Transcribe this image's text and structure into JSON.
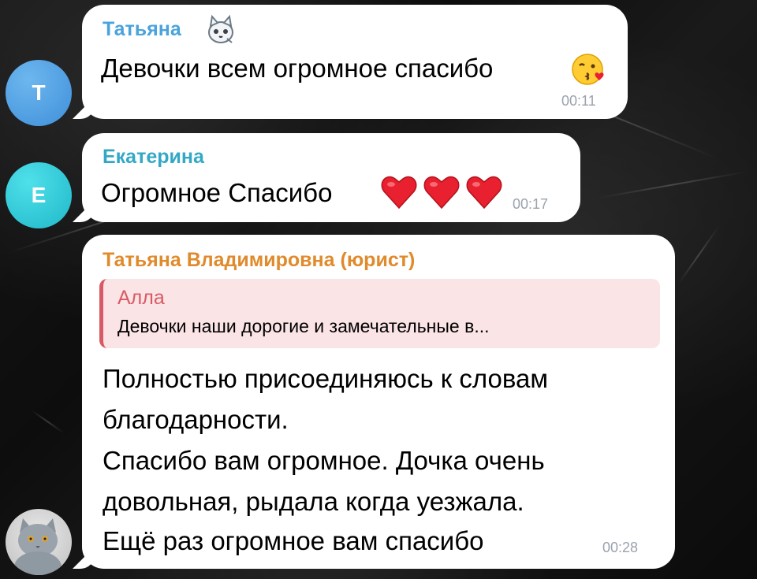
{
  "colors": {
    "sender_1": "#4aa3dc",
    "sender_2": "#33a8c6",
    "sender_3": "#e08a2b",
    "reply_accent": "#d85b64",
    "avatar_t": "#4a9fe2",
    "avatar_e": "#27c7d6"
  },
  "messages": [
    {
      "avatar_letter": "Т",
      "sender": "Татьяна",
      "text": "Девочки всем огромное спасибо",
      "time": "00:11",
      "emoji": "kissing-face-with-heart"
    },
    {
      "avatar_letter": "Е",
      "sender": "Екатерина",
      "text": "Огромное Спасибо",
      "time": "00:17",
      "emoji": "red-hearts"
    },
    {
      "avatar": "cat-photo",
      "sender": "Татьяна Владимировна (юрист)",
      "reply": {
        "name": "Алла",
        "text": "Девочки наши дорогие и замечательные в..."
      },
      "lines": [
        "Полностью присоединяюсь к словам",
        "благодарности.",
        "Спасибо вам огромное. Дочка очень",
        "довольная, рыдала когда уезжала.",
        "Ещё раз огромное вам спасибо"
      ],
      "time": "00:28"
    }
  ]
}
